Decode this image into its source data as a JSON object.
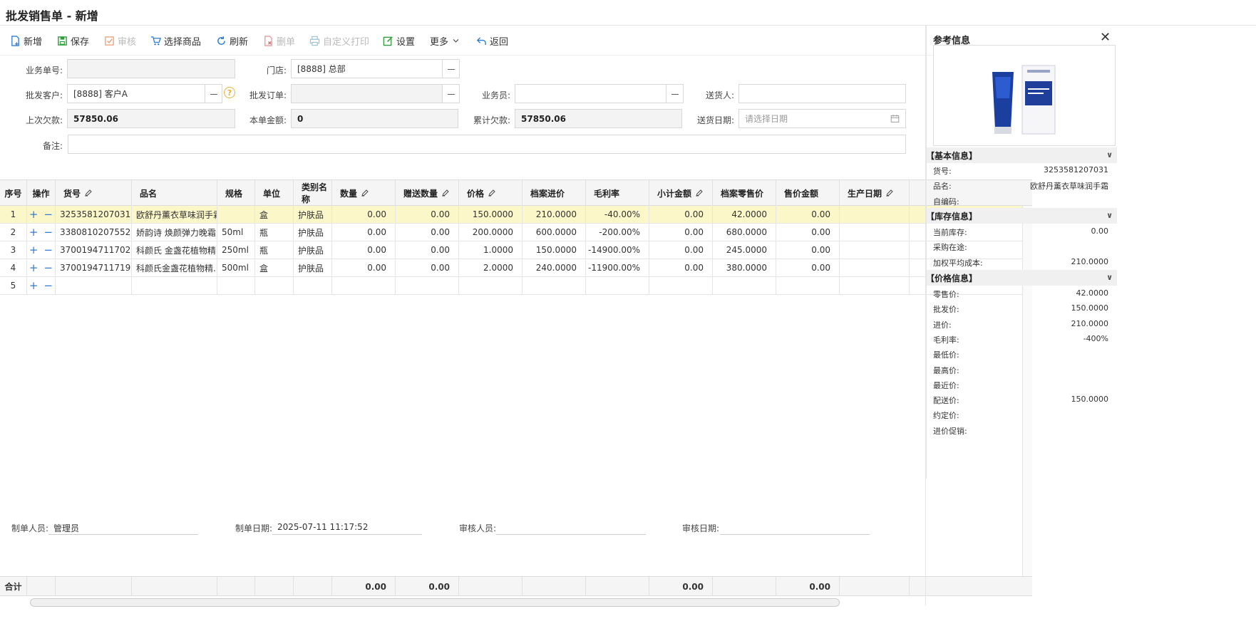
{
  "window": {
    "title": "批发销售单 - 新增"
  },
  "toolbar": {
    "new": "新增",
    "save": "保存",
    "audit": "审核",
    "select_goods": "选择商品",
    "refresh": "刷新",
    "delete": "删单",
    "custom_print": "自定义打印",
    "settings": "设置",
    "more": "更多",
    "back": "返回"
  },
  "form": {
    "order_no_label": "业务单号:",
    "order_no": "",
    "store_label": "门店:",
    "store": "[8888] 总部",
    "customer_label": "批发客户:",
    "customer": "[8888] 客户A",
    "wholesale_order_label": "批发订单:",
    "wholesale_order": "",
    "salesman_label": "业务员:",
    "salesman": "",
    "deliverer_label": "送货人:",
    "deliverer": "",
    "last_debt_label": "上次欠款:",
    "last_debt": "57850.06",
    "this_amount_label": "本单金额:",
    "this_amount": "0",
    "total_debt_label": "累计欠款:",
    "total_debt": "57850.06",
    "delivery_date_label": "送货日期:",
    "delivery_date_placeholder": "请选择日期",
    "remark_label": "备注:",
    "remark": "",
    "lookup": "---",
    "help": "?"
  },
  "table": {
    "headers": [
      "序号",
      "操作",
      "货号",
      "品名",
      "规格",
      "单位",
      "类别名称",
      "数量",
      "赠送数量",
      "价格",
      "档案进价",
      "毛利率",
      "小计金额",
      "档案零售价",
      "售价金额",
      "生产日期"
    ],
    "add": "+",
    "remove": "−",
    "rows": [
      {
        "no": "1",
        "code": "3253581207031",
        "name": "欧舒丹薰衣草味润手霜",
        "spec": "",
        "unit": "盒",
        "cat": "护肤品",
        "qty": "0.00",
        "gift": "0.00",
        "price": "150.0000",
        "cost": "210.0000",
        "margin": "-40.00%",
        "subtotal": "0.00",
        "retail": "42.0000",
        "sale": "0.00",
        "date": ""
      },
      {
        "no": "2",
        "code": "3380810207552",
        "name": "娇韵诗 焕颜弹力晚霜",
        "spec": "50ml",
        "unit": "瓶",
        "cat": "护肤品",
        "qty": "0.00",
        "gift": "0.00",
        "price": "200.0000",
        "cost": "600.0000",
        "margin": "-200.00%",
        "subtotal": "0.00",
        "retail": "680.0000",
        "sale": "0.00",
        "date": ""
      },
      {
        "no": "3",
        "code": "3700194711702",
        "name": "科颜氏 金盏花植物精...",
        "spec": "250ml",
        "unit": "瓶",
        "cat": "护肤品",
        "qty": "0.00",
        "gift": "0.00",
        "price": "1.0000",
        "cost": "150.0000",
        "margin": "-14900.00%",
        "subtotal": "0.00",
        "retail": "245.0000",
        "sale": "0.00",
        "date": ""
      },
      {
        "no": "4",
        "code": "3700194711719",
        "name": "科颜氏金盏花植物精...",
        "spec": "500ml",
        "unit": "盒",
        "cat": "护肤品",
        "qty": "0.00",
        "gift": "0.00",
        "price": "2.0000",
        "cost": "240.0000",
        "margin": "-11900.00%",
        "subtotal": "0.00",
        "retail": "380.0000",
        "sale": "0.00",
        "date": ""
      },
      {
        "no": "5",
        "code": "",
        "name": "",
        "spec": "",
        "unit": "",
        "cat": "",
        "qty": "",
        "gift": "",
        "price": "",
        "cost": "",
        "margin": "",
        "subtotal": "",
        "retail": "",
        "sale": "",
        "date": ""
      }
    ],
    "footer": {
      "label": "合计",
      "qty": "0.00",
      "gift": "0.00",
      "subtotal": "0.00",
      "sale": "0.00"
    }
  },
  "bottom": {
    "creator_label": "制单人员:",
    "creator": "管理员",
    "create_date_label": "制单日期:",
    "create_date": "2025-07-11 11:17:52",
    "auditor_label": "审核人员:",
    "auditor": "",
    "audit_date_label": "审核日期:",
    "audit_date": ""
  },
  "reference": {
    "title": "参考信息",
    "close": "✕",
    "basic_title": "【基本信息】",
    "basic": [
      {
        "k": "货号:",
        "v": "3253581207031"
      },
      {
        "k": "品名:",
        "v": "欧舒丹薰衣草味润手霜"
      },
      {
        "k": "自编码:",
        "v": ""
      }
    ],
    "stock_title": "【库存信息】",
    "stock": [
      {
        "k": "当前库存:",
        "v": "0.00"
      },
      {
        "k": "采购在途:",
        "v": ""
      },
      {
        "k": "加权平均成本:",
        "v": "210.0000"
      }
    ],
    "price_title": "【价格信息】",
    "price": [
      {
        "k": "零售价:",
        "v": "42.0000"
      },
      {
        "k": "批发价:",
        "v": "150.0000"
      },
      {
        "k": "进价:",
        "v": "210.0000"
      },
      {
        "k": "毛利率:",
        "v": "-400%"
      },
      {
        "k": "最低价:",
        "v": ""
      },
      {
        "k": "最高价:",
        "v": ""
      },
      {
        "k": "最近价:",
        "v": ""
      },
      {
        "k": "配送价:",
        "v": "150.0000"
      },
      {
        "k": "约定价:",
        "v": ""
      },
      {
        "k": "进价促销:",
        "v": ""
      }
    ]
  },
  "colors": {
    "accent": "#2f7bd6",
    "selected_row": "#fbf7c9",
    "save_green": "#2e9d3a",
    "delete_red": "#e06060",
    "edit_green": "#2e9d3a"
  }
}
